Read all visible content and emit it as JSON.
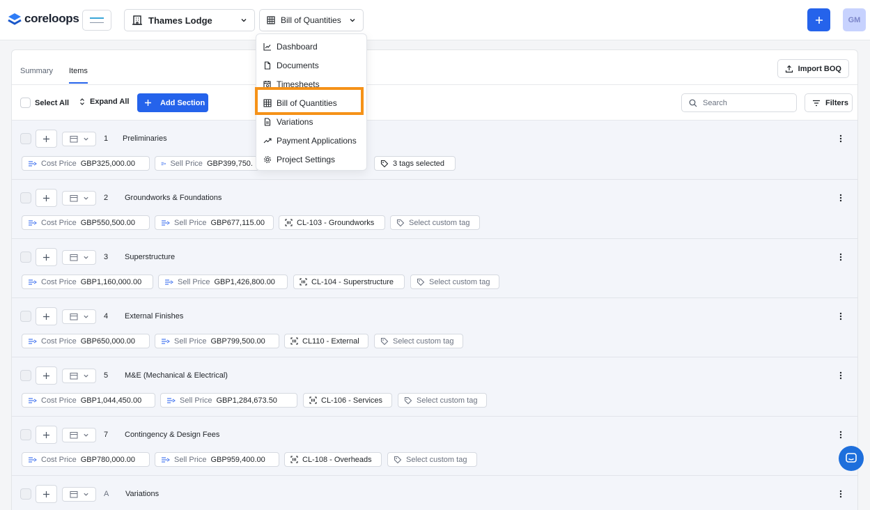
{
  "brand": {
    "name": "coreloops",
    "accent": "#2563eb",
    "highlight": "#f59218"
  },
  "header": {
    "project": "Thames Lodge",
    "module": "Bill of Quantities",
    "avatar_initials": "GM"
  },
  "tabs": [
    {
      "label": "Summary"
    },
    {
      "label": "Items"
    }
  ],
  "active_tab": "Items",
  "import_label": "Import BOQ",
  "toolbar": {
    "select_all": "Select All",
    "expand_all": "Expand All",
    "add_section": "Add Section",
    "search_placeholder": "Search",
    "filters": "Filters"
  },
  "dropdown": {
    "items": [
      {
        "label": "Dashboard",
        "icon": "chart-line-icon"
      },
      {
        "label": "Documents",
        "icon": "file-icon"
      },
      {
        "label": "Timesheets",
        "icon": "calendar-clock-icon"
      },
      {
        "label": "Bill of Quantities",
        "icon": "table-icon",
        "highlighted": true
      },
      {
        "label": "Variations",
        "icon": "file-text-icon"
      },
      {
        "label": "Payment Applications",
        "icon": "trending-up-icon"
      },
      {
        "label": "Project Settings",
        "icon": "gear-icon"
      }
    ]
  },
  "labels": {
    "cost_price": "Cost Price",
    "sell_price": "Sell Price",
    "select_custom_tag": "Select custom tag"
  },
  "sections": [
    {
      "number": "1",
      "title": "Preliminaries",
      "cost": "GBP325,000.00",
      "sell": "GBP399,750.",
      "code": "",
      "tag": "3 tags selected"
    },
    {
      "number": "2",
      "title": "Groundworks & Foundations",
      "cost": "GBP550,500.00",
      "sell": "GBP677,115.00",
      "code": "CL-103 - Groundworks",
      "tag": "Select custom tag"
    },
    {
      "number": "3",
      "title": "Superstructure",
      "cost": "GBP1,160,000.00",
      "sell": "GBP1,426,800.00",
      "code": "CL-104 - Superstructure",
      "tag": "Select custom tag"
    },
    {
      "number": "4",
      "title": "External Finishes",
      "cost": "GBP650,000.00",
      "sell": "GBP799,500.00",
      "code": "CL110 - External",
      "tag": "Select custom tag"
    },
    {
      "number": "5",
      "title": "M&E (Mechanical & Electrical)",
      "cost": "GBP1,044,450.00",
      "sell": "GBP1,284,673.50",
      "code": "CL-106 - Services",
      "tag": "Select custom tag"
    },
    {
      "number": "7",
      "title": "Contingency & Design Fees",
      "cost": "GBP780,000.00",
      "sell": "GBP959,400.00",
      "code": "CL-108 - Overheads",
      "tag": "Select custom tag"
    },
    {
      "number": "A",
      "title": "Variations",
      "cost": "",
      "sell": "",
      "code": "",
      "tag": ""
    }
  ]
}
